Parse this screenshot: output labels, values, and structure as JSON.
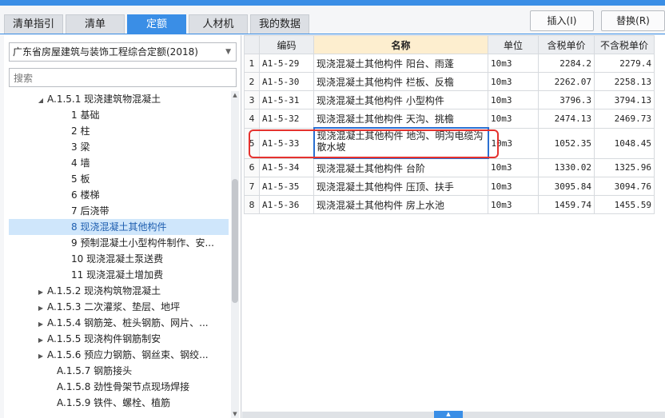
{
  "tabs": [
    "清单指引",
    "清单",
    "定额",
    "人材机",
    "我的数据"
  ],
  "active_tab": "定额",
  "buttons": {
    "insert": "插入(I)",
    "replace": "替换(R)"
  },
  "library_select": "广东省房屋建筑与装饰工程综合定额(2018)",
  "search_placeholder": "搜索",
  "tree": [
    {
      "label": "A.1.5.1 现浇建筑物混凝土",
      "caret": "◢"
    },
    {
      "label": "1 基础"
    },
    {
      "label": "2 柱"
    },
    {
      "label": "3 梁"
    },
    {
      "label": "4 墙"
    },
    {
      "label": "5 板"
    },
    {
      "label": "6 楼梯"
    },
    {
      "label": "7 后浇带"
    },
    {
      "label": "8 现浇混凝土其他构件",
      "selected": true
    },
    {
      "label": "9 预制混凝土小型构件制作、安..."
    },
    {
      "label": "10 现浇混凝土泵送费"
    },
    {
      "label": "11 现浇混凝土增加费"
    },
    {
      "label": "A.1.5.2 现浇构筑物混凝土",
      "caret": "▶"
    },
    {
      "label": "A.1.5.3 二次灌浆、垫层、地坪",
      "caret": "▶"
    },
    {
      "label": "A.1.5.4 钢筋笼、桩头钢筋、网片、...",
      "caret": "▶"
    },
    {
      "label": "A.1.5.5 现浇构件钢筋制安",
      "caret": "▶"
    },
    {
      "label": "A.1.5.6 预应力钢筋、钢丝束、钢绞...",
      "caret": "▶"
    },
    {
      "label": "A.1.5.7 钢筋接头"
    },
    {
      "label": "A.1.5.8 劲性骨架节点现场焊接"
    },
    {
      "label": "A.1.5.9 铁件、螺栓、植筋"
    }
  ],
  "table": {
    "headers": [
      "",
      "编码",
      "名称",
      "单位",
      "含税单价",
      "不含税单价"
    ],
    "rows": [
      {
        "idx": "1",
        "code": "A1-5-29",
        "name": "现浇混凝土其他构件 阳台、雨蓬",
        "unit": "10m3",
        "tax": "2284.2",
        "notax": "2279.4"
      },
      {
        "idx": "2",
        "code": "A1-5-30",
        "name": "现浇混凝土其他构件 栏板、反檐",
        "unit": "10m3",
        "tax": "2262.07",
        "notax": "2258.13"
      },
      {
        "idx": "3",
        "code": "A1-5-31",
        "name": "现浇混凝土其他构件 小型构件",
        "unit": "10m3",
        "tax": "3796.3",
        "notax": "3794.13"
      },
      {
        "idx": "4",
        "code": "A1-5-32",
        "name": "现浇混凝土其他构件 天沟、挑檐",
        "unit": "10m3",
        "tax": "2474.13",
        "notax": "2469.73"
      },
      {
        "idx": "5",
        "code": "A1-5-33",
        "name": "现浇混凝土其他构件 地沟、明沟电缆沟散水坡",
        "unit": "10m3",
        "tax": "1052.35",
        "notax": "1048.45"
      },
      {
        "idx": "6",
        "code": "A1-5-34",
        "name": "现浇混凝土其他构件 台阶",
        "unit": "10m3",
        "tax": "1330.02",
        "notax": "1325.96"
      },
      {
        "idx": "7",
        "code": "A1-5-35",
        "name": "现浇混凝土其他构件 压顶、扶手",
        "unit": "10m3",
        "tax": "3095.84",
        "notax": "3094.76"
      },
      {
        "idx": "8",
        "code": "A1-5-36",
        "name": "现浇混凝土其他构件 房上水池",
        "unit": "10m3",
        "tax": "1459.74",
        "notax": "1455.59"
      }
    ]
  }
}
